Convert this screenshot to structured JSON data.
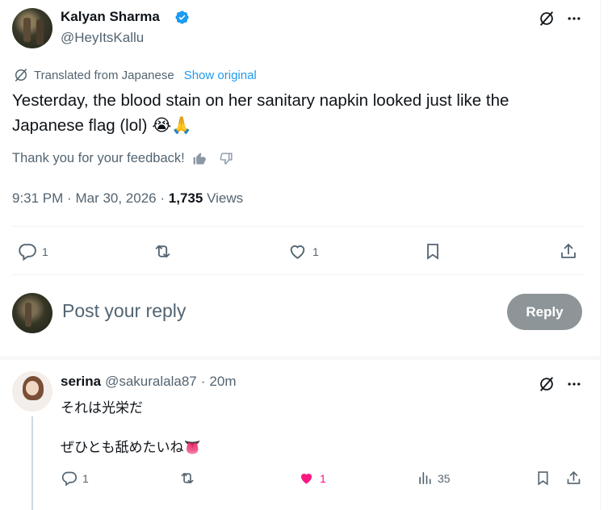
{
  "tweet": {
    "author_name": "Kalyan Sharma",
    "author_handle": "@HeyItsKallu",
    "translated_label": "Translated from Japanese",
    "show_original_label": "Show original",
    "text": "Yesterday, the blood stain on her sanitary napkin looked just like the Japanese flag (lol) 😭🙏",
    "feedback_label": "Thank you for your feedback!",
    "time": "9:31 PM",
    "date": "Mar 30, 2026",
    "separator": "·",
    "views_count": "1,735",
    "views_label": "Views",
    "actions": {
      "replies": "1",
      "retweets": "",
      "likes": "1"
    }
  },
  "composer": {
    "placeholder": "Post your reply",
    "reply_button": "Reply"
  },
  "reply": {
    "author_name": "serina",
    "author_handle": "@sakuralala87",
    "separator": "·",
    "time": "20m",
    "line1": "それは光栄だ",
    "line2": "ぜひとも舐めたいね👅",
    "actions": {
      "replies": "1",
      "retweets": "",
      "likes": "1",
      "views": "35"
    }
  },
  "colors": {
    "verified_blue": "#1d9bf0",
    "link_blue": "#1d9bf0",
    "liked_pink": "#f91880",
    "muted_gray": "#536471",
    "reply_button_gray": "#8e9598"
  },
  "icons": [
    "verified-badge-icon",
    "grok-icon",
    "more-icon",
    "translate-icon",
    "thumbs-up-icon",
    "thumbs-down-icon",
    "reply-icon",
    "retweet-icon",
    "like-icon",
    "bookmark-icon",
    "share-icon",
    "views-icon"
  ]
}
